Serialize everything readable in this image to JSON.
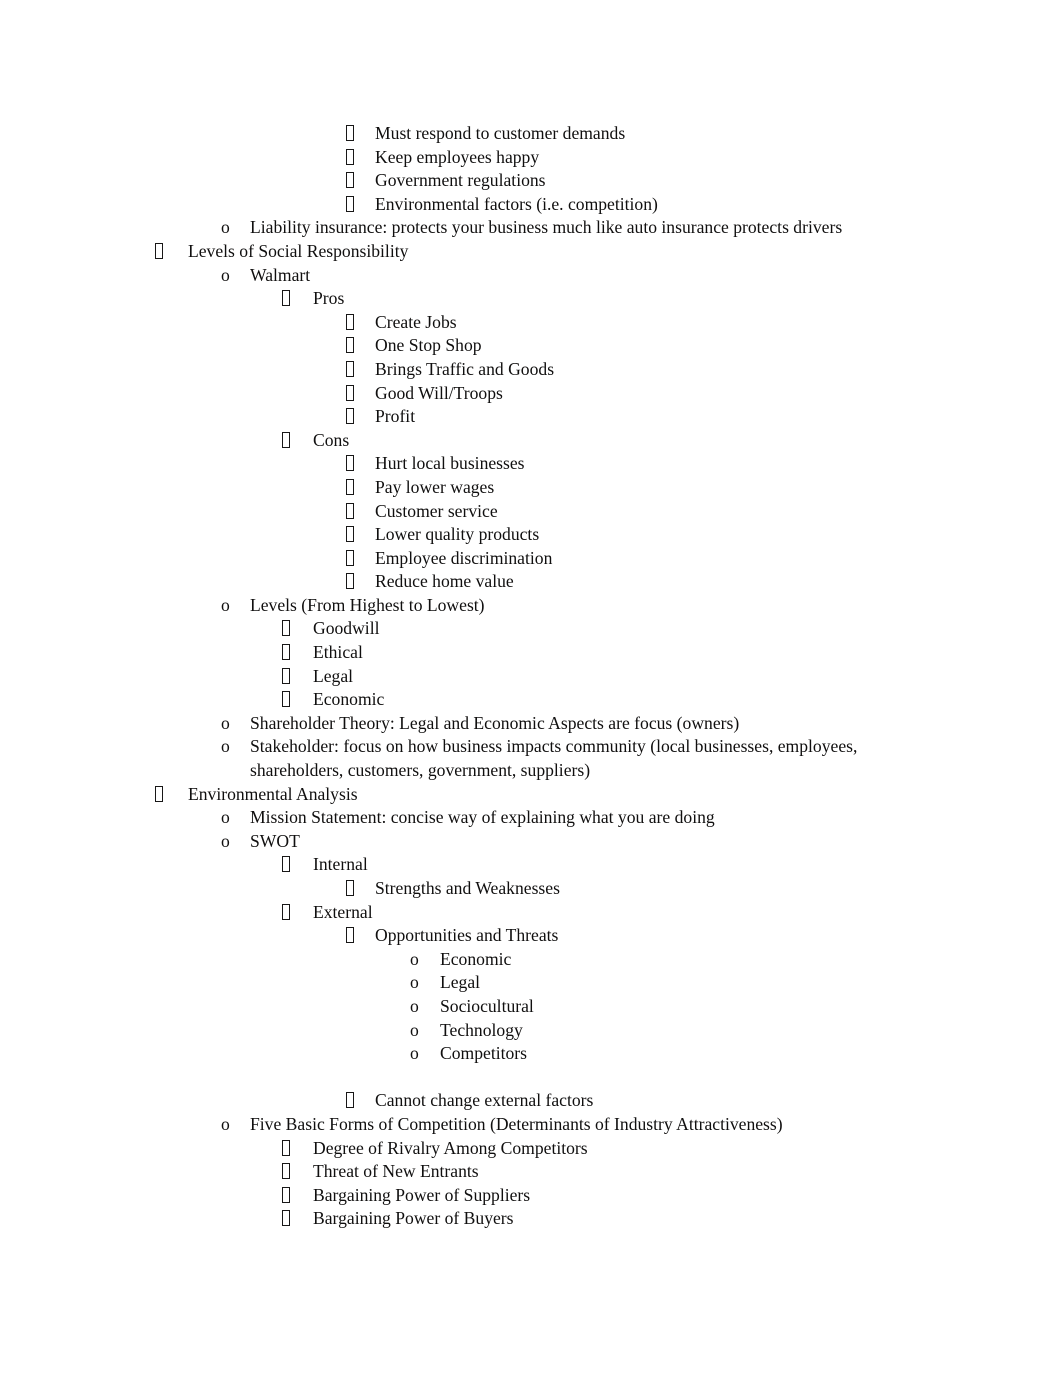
{
  "document": {
    "type": "outline-notes",
    "page_background": "#ffffff",
    "text_color": "#100f0f",
    "bullet_glyphs": {
      "level1": "missing-glyph-box",
      "level2": "o",
      "level3": "missing-glyph-box",
      "level4": "missing-glyph-box",
      "level5": "o"
    },
    "lines": [
      {
        "level": 4,
        "marker": "box",
        "text": "Must respond to customer demands"
      },
      {
        "level": 4,
        "marker": "box",
        "text": "Keep employees happy"
      },
      {
        "level": 4,
        "marker": "box",
        "text": "Government regulations"
      },
      {
        "level": 4,
        "marker": "box",
        "text": "Environmental factors (i.e. competition)"
      },
      {
        "level": 2,
        "marker": "o",
        "text": "Liability insurance: protects your business much like auto insurance protects drivers"
      },
      {
        "level": 1,
        "marker": "box",
        "text": "Levels of Social Responsibility"
      },
      {
        "level": 2,
        "marker": "o",
        "text": "Walmart"
      },
      {
        "level": 3,
        "marker": "box",
        "text": "Pros"
      },
      {
        "level": 4,
        "marker": "box",
        "text": "Create Jobs"
      },
      {
        "level": 4,
        "marker": "box",
        "text": "One Stop Shop"
      },
      {
        "level": 4,
        "marker": "box",
        "text": "Brings Traffic and Goods"
      },
      {
        "level": 4,
        "marker": "box",
        "text": "Good Will/Troops"
      },
      {
        "level": 4,
        "marker": "box",
        "text": "Profit"
      },
      {
        "level": 3,
        "marker": "box",
        "text": "Cons"
      },
      {
        "level": 4,
        "marker": "box",
        "text": "Hurt local businesses"
      },
      {
        "level": 4,
        "marker": "box",
        "text": "Pay lower wages"
      },
      {
        "level": 4,
        "marker": "box",
        "text": "Customer service"
      },
      {
        "level": 4,
        "marker": "box",
        "text": "Lower quality products"
      },
      {
        "level": 4,
        "marker": "box",
        "text": "Employee discrimination"
      },
      {
        "level": 4,
        "marker": "box",
        "text": "Reduce home value"
      },
      {
        "level": 2,
        "marker": "o",
        "text": "Levels (From Highest to Lowest)"
      },
      {
        "level": 3,
        "marker": "box",
        "text": "Goodwill"
      },
      {
        "level": 3,
        "marker": "box",
        "text": "Ethical"
      },
      {
        "level": 3,
        "marker": "box",
        "text": "Legal"
      },
      {
        "level": 3,
        "marker": "box",
        "text": "Economic"
      },
      {
        "level": 2,
        "marker": "o",
        "text": "Shareholder Theory: Legal and Economic Aspects are focus (owners)"
      },
      {
        "level": 2,
        "marker": "o",
        "text": "Stakeholder: focus on how business impacts community (local businesses, employees, shareholders, customers, government, suppliers)"
      },
      {
        "level": 1,
        "marker": "box",
        "text": "Environmental Analysis"
      },
      {
        "level": 2,
        "marker": "o",
        "text": "Mission Statement: concise way of explaining what you are doing"
      },
      {
        "level": 2,
        "marker": "o",
        "text": "SWOT"
      },
      {
        "level": 3,
        "marker": "box",
        "text": "Internal"
      },
      {
        "level": 4,
        "marker": "box",
        "text": "Strengths and Weaknesses"
      },
      {
        "level": 3,
        "marker": "box",
        "text": "External"
      },
      {
        "level": 4,
        "marker": "box",
        "text": "Opportunities and Threats"
      },
      {
        "level": 5,
        "marker": "o",
        "text": "Economic"
      },
      {
        "level": 5,
        "marker": "o",
        "text": "Legal"
      },
      {
        "level": 5,
        "marker": "o",
        "text": "Sociocultural"
      },
      {
        "level": 5,
        "marker": "o",
        "text": "Technology"
      },
      {
        "level": 5,
        "marker": "o",
        "text": "Competitors"
      },
      {
        "level": 0,
        "marker": "none",
        "text": ""
      },
      {
        "level": 4,
        "marker": "box",
        "text": "Cannot change external factors"
      },
      {
        "level": 2,
        "marker": "o",
        "text": "Five Basic Forms of Competition (Determinants of Industry Attractiveness)"
      },
      {
        "level": 3,
        "marker": "box",
        "text": "Degree of Rivalry Among Competitors"
      },
      {
        "level": 3,
        "marker": "box",
        "text": "Threat of New Entrants"
      },
      {
        "level": 3,
        "marker": "box",
        "text": "Bargaining Power of Suppliers"
      },
      {
        "level": 3,
        "marker": "box",
        "text": "Bargaining Power of Buyers"
      }
    ]
  }
}
